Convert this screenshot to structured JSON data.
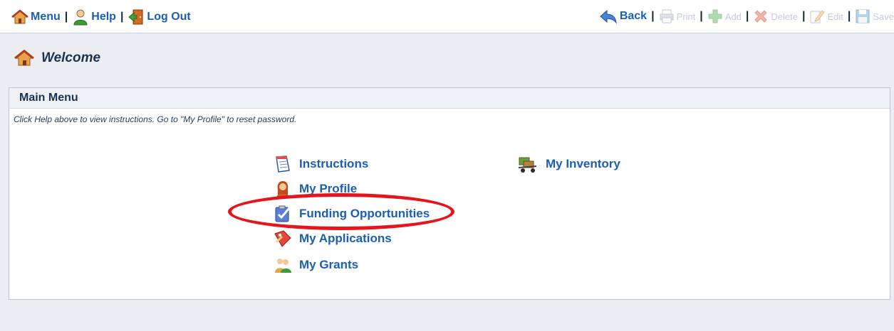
{
  "toolbar": {
    "left": [
      {
        "label": "Menu",
        "icon": "home-icon"
      },
      {
        "label": "Help",
        "icon": "user-help-icon"
      },
      {
        "label": "Log Out",
        "icon": "exit-door-icon"
      }
    ],
    "right": [
      {
        "label": "Back",
        "icon": "back-arrow-icon"
      },
      {
        "label": "Print",
        "icon": "printer-icon"
      },
      {
        "label": "Add",
        "icon": "plus-icon"
      },
      {
        "label": "Delete",
        "icon": "delete-x-icon"
      },
      {
        "label": "Edit",
        "icon": "pencil-icon"
      },
      {
        "label": "Save",
        "icon": "floppy-icon"
      }
    ],
    "separator": "|"
  },
  "welcome": {
    "title": "Welcome"
  },
  "main_menu": {
    "title": "Main Menu",
    "note": "Click Help above to view instructions. Go to \"My Profile\" to reset password.",
    "items": [
      {
        "label": "Instructions"
      },
      {
        "label": "My Profile"
      },
      {
        "label": "Funding Opportunities",
        "highlighted": true
      },
      {
        "label": "My Applications"
      },
      {
        "label": "My Grants"
      },
      {
        "label": "My Inventory"
      }
    ]
  },
  "colors": {
    "link": "#1a5fb4",
    "highlight_ring": "#e8141b",
    "band": "#ebedf0"
  }
}
